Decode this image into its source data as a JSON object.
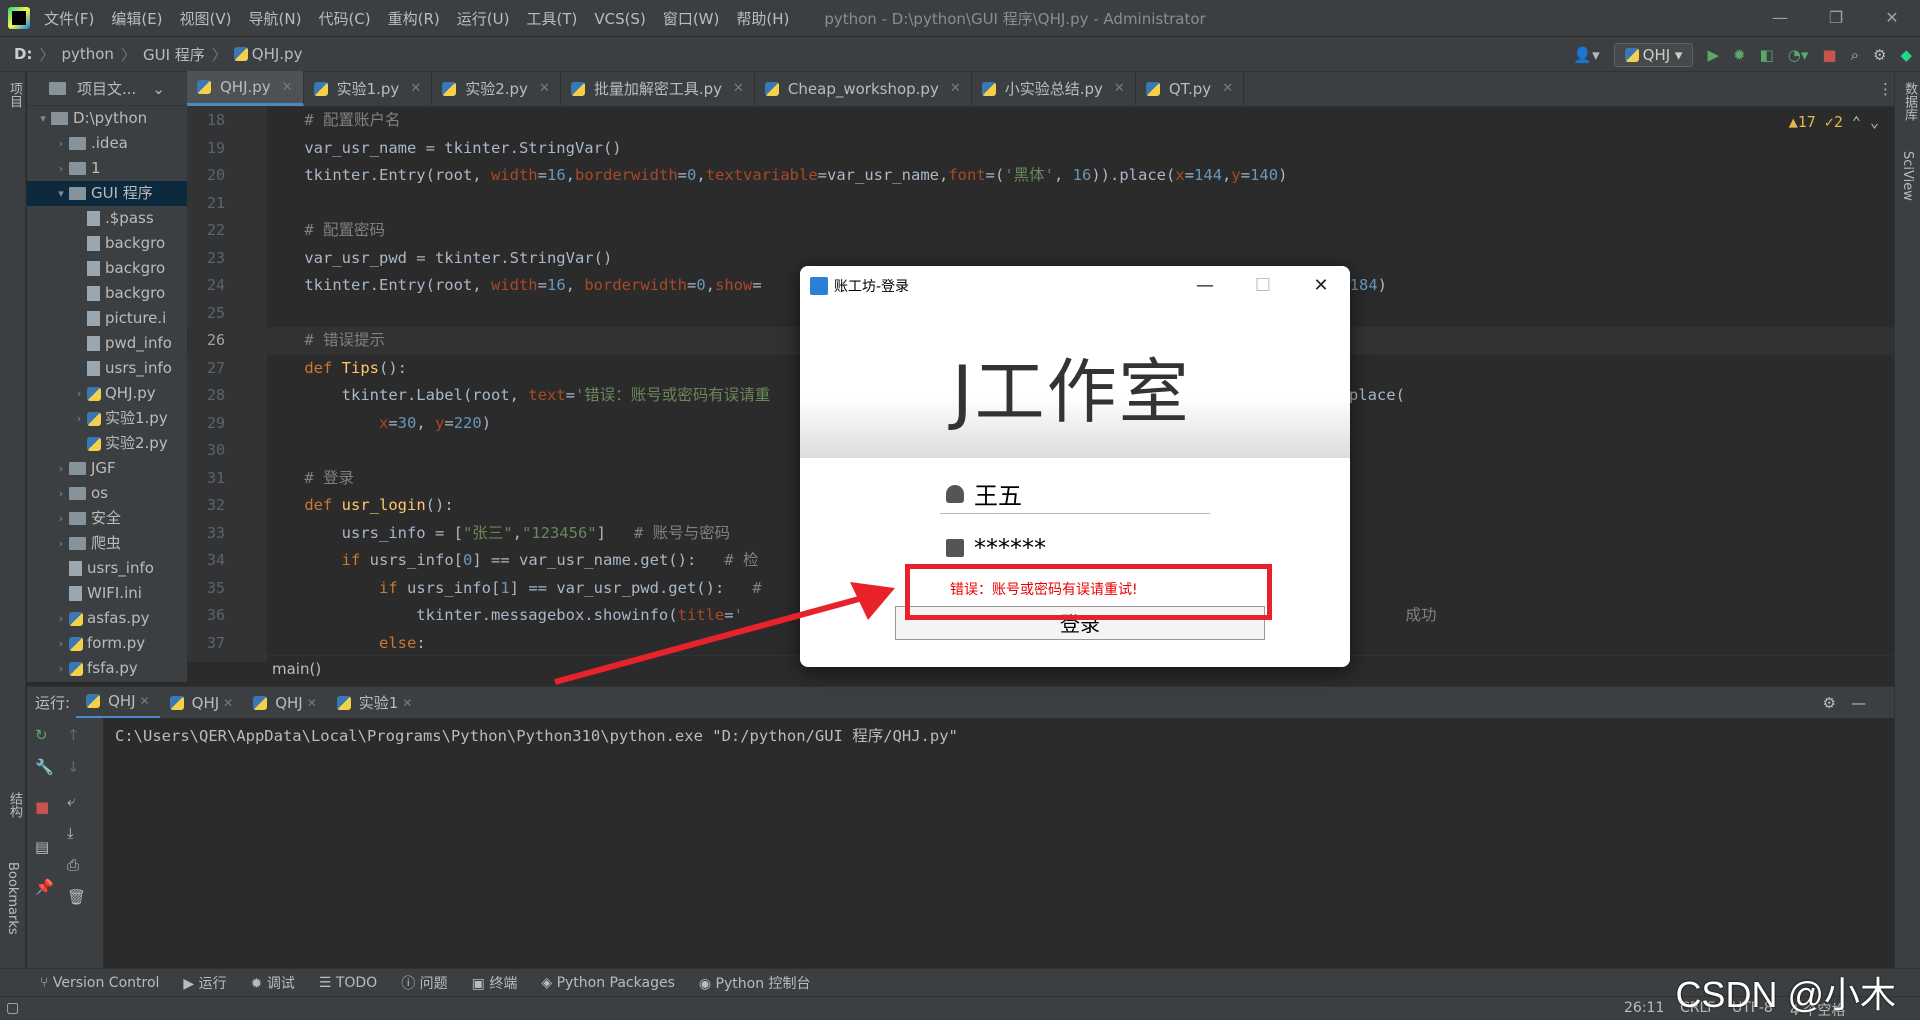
{
  "titlebar": {
    "menu": [
      "文件(F)",
      "编辑(E)",
      "视图(V)",
      "导航(N)",
      "代码(C)",
      "重构(R)",
      "运行(U)",
      "工具(T)",
      "VCS(S)",
      "窗口(W)",
      "帮助(H)"
    ],
    "title": "python - D:\\python\\GUI 程序\\QHJ.py - Administrator"
  },
  "nav": {
    "drive": "D:",
    "crumbs": [
      "python",
      "GUI 程序",
      "QHJ.py"
    ],
    "run_config": "QHJ"
  },
  "tabs": [
    "QHJ.py",
    "实验1.py",
    "实验2.py",
    "批量加解密工具.py",
    "Cheap_workshop.py",
    "小实验总结.py",
    "QT.py"
  ],
  "project": {
    "header": "项目文...",
    "items": [
      {
        "label": "D:\\python",
        "type": "folder",
        "indent": 0,
        "arrow": "▾"
      },
      {
        "label": ".idea",
        "type": "folder",
        "indent": 1,
        "arrow": "›"
      },
      {
        "label": "1",
        "type": "folder",
        "indent": 1,
        "arrow": "›"
      },
      {
        "label": "GUI 程序",
        "type": "folder",
        "indent": 1,
        "arrow": "▾",
        "selected": true
      },
      {
        "label": ".$pass",
        "type": "file",
        "indent": 2,
        "arrow": ""
      },
      {
        "label": "backgro",
        "type": "file",
        "indent": 2,
        "arrow": ""
      },
      {
        "label": "backgro",
        "type": "file",
        "indent": 2,
        "arrow": ""
      },
      {
        "label": "backgro",
        "type": "file",
        "indent": 2,
        "arrow": ""
      },
      {
        "label": "picture.i",
        "type": "file",
        "indent": 2,
        "arrow": ""
      },
      {
        "label": "pwd_info",
        "type": "file",
        "indent": 2,
        "arrow": ""
      },
      {
        "label": "usrs_info",
        "type": "file",
        "indent": 2,
        "arrow": ""
      },
      {
        "label": "QHJ.py",
        "type": "py",
        "indent": 2,
        "arrow": "›"
      },
      {
        "label": "实验1.py",
        "type": "py",
        "indent": 2,
        "arrow": "›"
      },
      {
        "label": "实验2.py",
        "type": "py",
        "indent": 2,
        "arrow": ""
      },
      {
        "label": "JGF",
        "type": "folder",
        "indent": 1,
        "arrow": "›"
      },
      {
        "label": "os",
        "type": "folder",
        "indent": 1,
        "arrow": "›"
      },
      {
        "label": "安全",
        "type": "folder",
        "indent": 1,
        "arrow": "›"
      },
      {
        "label": "爬虫",
        "type": "folder",
        "indent": 1,
        "arrow": "›"
      },
      {
        "label": "usrs_info",
        "type": "file",
        "indent": 1,
        "arrow": ""
      },
      {
        "label": "WIFI.ini",
        "type": "file",
        "indent": 1,
        "arrow": ""
      },
      {
        "label": "asfas.py",
        "type": "py",
        "indent": 1,
        "arrow": "›"
      },
      {
        "label": "form.py",
        "type": "py",
        "indent": 1,
        "arrow": "›"
      },
      {
        "label": "fsfa.py",
        "type": "py",
        "indent": 1,
        "arrow": "›"
      }
    ]
  },
  "editor": {
    "line_numbers": [
      "18",
      "19",
      "20",
      "21",
      "22",
      "23",
      "24",
      "25",
      "26",
      "27",
      "28",
      "29",
      "30",
      "31",
      "32",
      "33",
      "34",
      "35",
      "36",
      "37"
    ],
    "inspection": "▲17 ✓2",
    "breadcrumb": "main()"
  },
  "run": {
    "label": "运行:",
    "tabs": [
      "QHJ",
      "QHJ",
      "QHJ",
      "实验1"
    ],
    "command": "C:\\Users\\QER\\AppData\\Local\\Programs\\Python\\Python310\\python.exe \"D:/python/GUI 程序/QHJ.py\""
  },
  "bottom_tabs": [
    "Version Control",
    "运行",
    "调试",
    "TODO",
    "问题",
    "终端",
    "Python Packages",
    "Python 控制台"
  ],
  "status": {
    "pos": "26:11",
    "crlf": "CRLF",
    "enc": "UTF-8",
    "indent": "4 个空格"
  },
  "left_strip": {
    "project": "项目",
    "structure": "结构",
    "bookmarks": "Bookmarks"
  },
  "right_strip": {
    "db": "数据库",
    "sciview": "SciView"
  },
  "dialog": {
    "title": "账工坊-登录",
    "banner": "J工作室",
    "username": "王五",
    "password": "******",
    "error": "错误：账号或密码有误请重试!",
    "login": "登录"
  },
  "watermark": "CSDN @小木",
  "colors": {
    "accent": "#4a88c7",
    "error": "#e8222a"
  }
}
